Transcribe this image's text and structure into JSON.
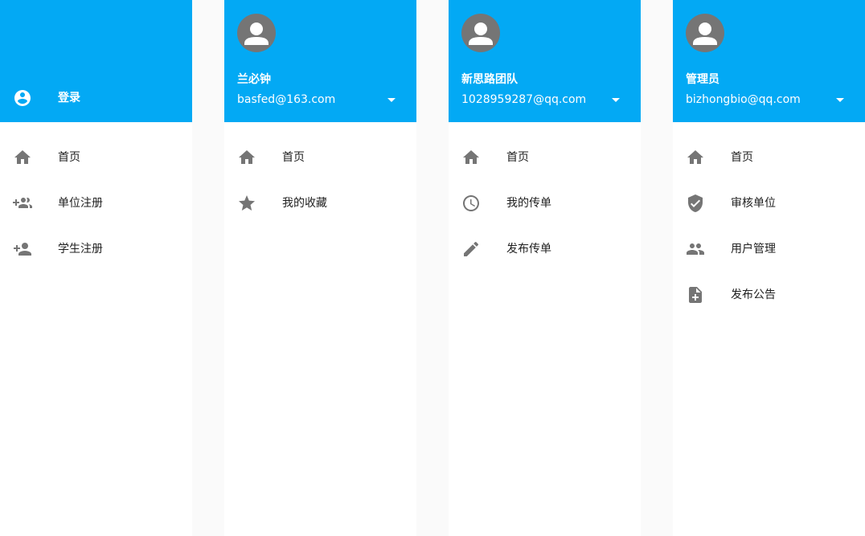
{
  "colors": {
    "header_bg": "#03a9f4",
    "icon_gray": "#757575",
    "avatar_gray": "#757575",
    "text": "#212121"
  },
  "guest_drawer": {
    "login": {
      "icon": "account-circle-icon",
      "label": "登录"
    },
    "items": [
      {
        "icon": "home-icon",
        "label": "首页"
      },
      {
        "icon": "group-add-icon",
        "label": "单位注册"
      },
      {
        "icon": "person-add-icon",
        "label": "学生注册"
      }
    ]
  },
  "student_drawer": {
    "user": {
      "name": "兰必钟",
      "email": "basfed@163.com"
    },
    "items": [
      {
        "icon": "home-icon",
        "label": "首页"
      },
      {
        "icon": "star-icon",
        "label": "我的收藏"
      }
    ]
  },
  "company_drawer": {
    "user": {
      "name": "新思路团队",
      "email": "1028959287@qq.com"
    },
    "items": [
      {
        "icon": "home-icon",
        "label": "首页"
      },
      {
        "icon": "clock-icon",
        "label": "我的传单"
      },
      {
        "icon": "pencil-icon",
        "label": "发布传单"
      }
    ]
  },
  "admin_drawer": {
    "user": {
      "name": "管理员",
      "email": "bizhongbio@qq.com"
    },
    "items": [
      {
        "icon": "verified-shield-icon",
        "label": "审核单位"
      },
      {
        "icon": "home-icon",
        "label": "首页"
      },
      {
        "icon": "people-icon",
        "label": "用户管理"
      },
      {
        "icon": "note-add-icon",
        "label": "发布公告"
      }
    ]
  }
}
